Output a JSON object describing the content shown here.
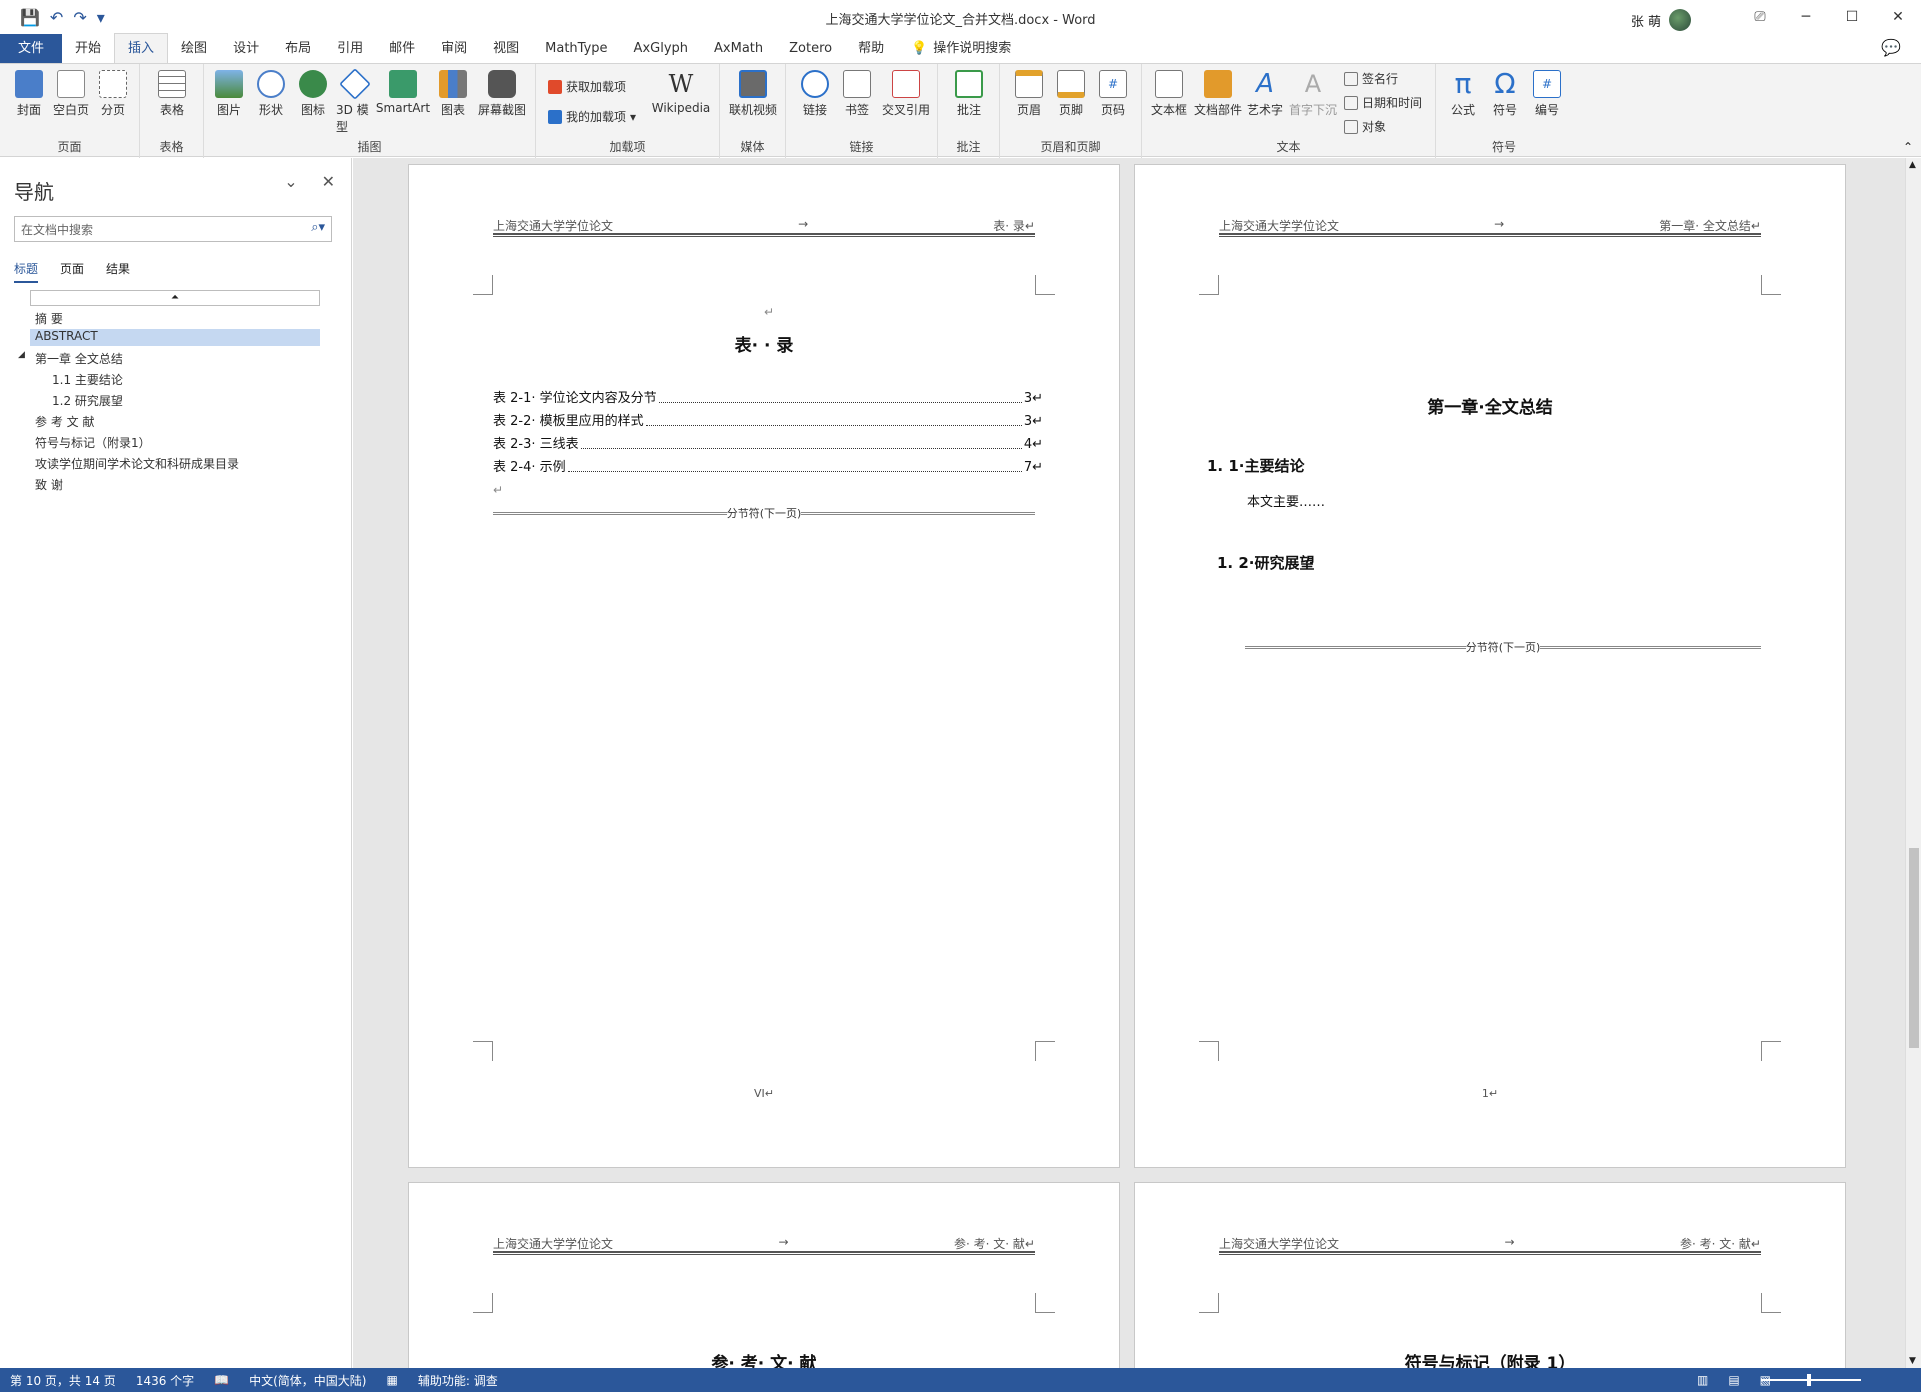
{
  "window": {
    "title": "上海交通大学学位论文_合并文档.docx  -  Word",
    "user": "张 萌",
    "controls": [
      "⎚",
      "─",
      "☐",
      "✕"
    ]
  },
  "qat": {
    "save": "💾",
    "undo": "↶",
    "redo": "↷",
    "more": "▾"
  },
  "tabs": [
    "文件",
    "开始",
    "插入",
    "绘图",
    "设计",
    "布局",
    "引用",
    "邮件",
    "审阅",
    "视图",
    "MathType",
    "AxGlyph",
    "AxMath",
    "Zotero",
    "帮助"
  ],
  "active_tab": "插入",
  "tellme": "操作说明搜索",
  "ribbon": {
    "pages": {
      "label": "页面",
      "buttons": [
        "封面",
        "空白页",
        "分页"
      ]
    },
    "tables": {
      "label": "表格",
      "buttons": [
        "表格"
      ]
    },
    "illustrations": {
      "label": "插图",
      "buttons": [
        "图片",
        "形状",
        "图标",
        "3D 模型",
        "SmartArt",
        "图表",
        "屏幕截图"
      ]
    },
    "addins": {
      "label": "加载项",
      "get": "获取加载项",
      "mine": "我的加载项",
      "wiki": "Wikipedia"
    },
    "media": {
      "label": "媒体",
      "buttons": [
        "联机视频"
      ]
    },
    "links": {
      "label": "链接",
      "buttons": [
        "链接",
        "书签",
        "交叉引用"
      ]
    },
    "comments": {
      "label": "批注",
      "buttons": [
        "批注"
      ]
    },
    "headerfooter": {
      "label": "页眉和页脚",
      "buttons": [
        "页眉",
        "页脚",
        "页码"
      ]
    },
    "text": {
      "label": "文本",
      "buttons": [
        "文本框",
        "文档部件",
        "艺术字",
        "首字下沉"
      ],
      "sig": "签名行",
      "date": "日期和时间",
      "obj": "对象"
    },
    "symbols": {
      "label": "符号",
      "buttons": [
        "公式",
        "符号",
        "编号"
      ]
    }
  },
  "nav": {
    "title": "导航",
    "search_placeholder": "在文档中搜索",
    "tabs": [
      "标题",
      "页面",
      "结果"
    ],
    "headings": [
      "摘 要",
      "ABSTRACT",
      "第一章 全文总结",
      "1.1 主要结论",
      "1.2 研究展望",
      "参 考 文 献",
      "符号与标记（附录1）",
      "攻读学位期间学术论文和科研成果目录",
      "致 谢"
    ]
  },
  "pages": {
    "p1": {
      "header_left": "上海交通大学学位论文",
      "header_arrow": "→",
      "header_right": "表· 录↵",
      "return_mark": "↵",
      "title": "表· · 录",
      "toc": [
        {
          "text": "表 2-1· 学位论文内容及分节",
          "page": "3↵"
        },
        {
          "text": "表 2-2· 模板里应用的样式",
          "page": "3↵"
        },
        {
          "text": "表 2-3· 三线表",
          "page": "4↵"
        },
        {
          "text": "表 2-4· 示例",
          "page": "7↵"
        }
      ],
      "section_break": "分节符(下一页)",
      "footer": "VI↵"
    },
    "p2": {
      "header_left": "上海交通大学学位论文",
      "header_arrow": "→",
      "header_right": "第一章· 全文总结↵",
      "chapter": "第一章·全文总结",
      "h11": "1. 1·主要结论",
      "body": "本文主要……",
      "h12": "1. 2·研究展望",
      "section_break": "分节符(下一页)",
      "footer": "1↵"
    },
    "p3": {
      "header_left": "上海交通大学学位论文",
      "header_arrow": "→",
      "header_right": "参· 考· 文· 献↵",
      "title": "参· 考· 文· 献"
    },
    "p4": {
      "header_left": "上海交通大学学位论文",
      "header_arrow": "→",
      "header_right": "参· 考· 文· 献↵",
      "title": "符号与标记（附录 1）"
    }
  },
  "status": {
    "page": "第 10 页，共 14 页",
    "words": "1436 个字",
    "lang": "中文(简体，中国大陆)",
    "access": "辅助功能: 调查"
  },
  "colors": {
    "accent": "#2b579a",
    "ribbon_bg": "#f3f3f3",
    "nav_selected": "#c5d8f1"
  }
}
